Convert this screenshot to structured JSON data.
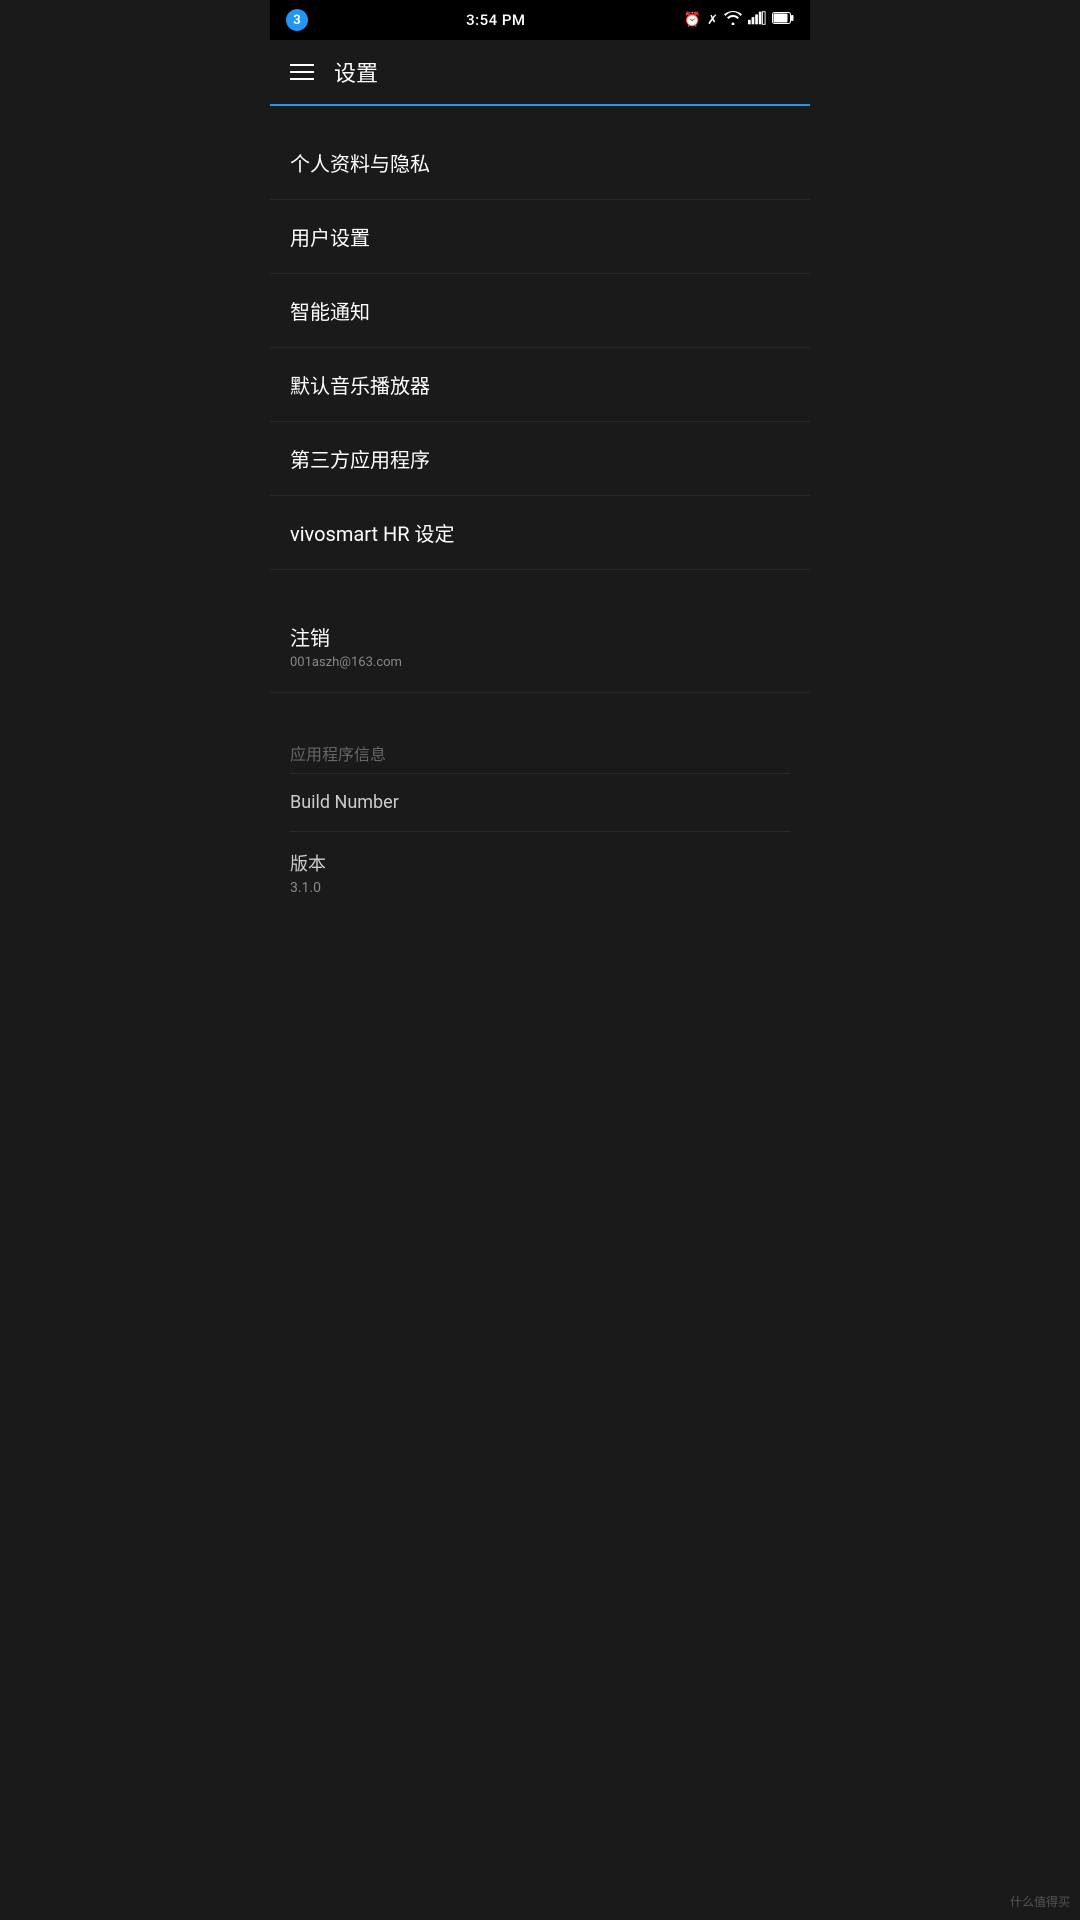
{
  "statusBar": {
    "badge": "3",
    "time": "3:54 PM",
    "icons": [
      "alarm",
      "bluetooth",
      "wifi",
      "signal",
      "battery"
    ]
  },
  "topBar": {
    "title": "设置"
  },
  "menuItems": [
    {
      "id": "profile-privacy",
      "title": "个人资料与隐私",
      "subtitle": null
    },
    {
      "id": "user-settings",
      "title": "用户设置",
      "subtitle": null
    },
    {
      "id": "smart-notification",
      "title": "智能通知",
      "subtitle": null
    },
    {
      "id": "default-music-player",
      "title": "默认音乐播放器",
      "subtitle": null
    },
    {
      "id": "third-party-apps",
      "title": "第三方应用程序",
      "subtitle": null
    },
    {
      "id": "vivosmart-settings",
      "title": "vivosmart HR 设定",
      "subtitle": null
    }
  ],
  "accountSection": {
    "signout": {
      "title": "注销",
      "email": "001aszh@163.com"
    }
  },
  "appInfo": {
    "sectionLabel": "应用程序信息",
    "items": [
      {
        "id": "build-number",
        "title": "Build Number",
        "value": ""
      },
      {
        "id": "version",
        "title": "版本",
        "value": "3.1.0"
      }
    ]
  },
  "watermark": "什么值得买"
}
